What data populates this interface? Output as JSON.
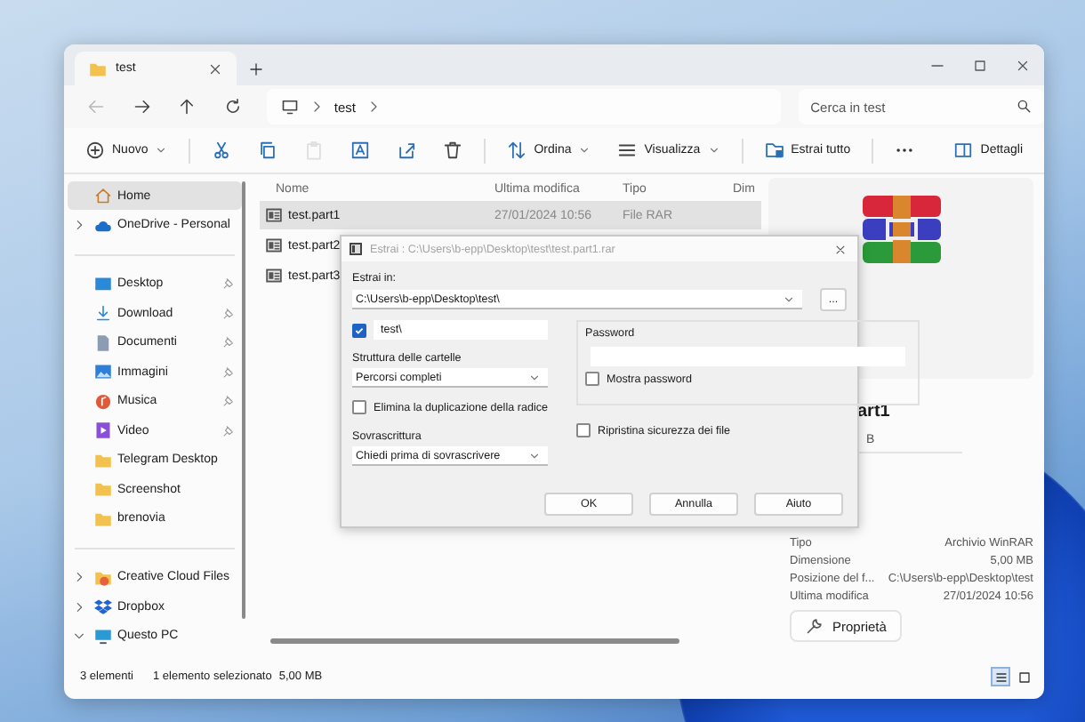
{
  "window": {
    "tabs": [
      {
        "label": "test",
        "selected": true
      }
    ]
  },
  "address": {
    "nav": [
      {
        "kind": "back",
        "disabled": true
      },
      {
        "kind": "forward",
        "disabled": false
      },
      {
        "kind": "up",
        "disabled": false
      },
      {
        "kind": "refresh",
        "disabled": false
      }
    ],
    "crumbs": [
      "test"
    ],
    "search": {
      "placeholder": "Cerca in test"
    }
  },
  "toolbar": {
    "groups": [
      [
        {
          "kind": "new",
          "label": "Nuovo",
          "disabled": false
        }
      ],
      [
        {
          "kind": "cut",
          "disabled": false
        },
        {
          "kind": "copy",
          "disabled": false
        },
        {
          "kind": "paste",
          "disabled": true
        },
        {
          "kind": "rename",
          "disabled": false
        },
        {
          "kind": "share",
          "disabled": false
        },
        {
          "kind": "delete",
          "disabled": false
        }
      ],
      [
        {
          "kind": "sort",
          "label": "Ordina",
          "disabled": false
        },
        {
          "kind": "view",
          "label": "Visualizza",
          "disabled": false
        }
      ],
      [
        {
          "kind": "extract",
          "label": "Estrai tutto",
          "disabled": false
        }
      ],
      [
        {
          "kind": "more",
          "disabled": false
        }
      ]
    ],
    "details": {
      "label": "Dettagli"
    }
  },
  "sidebar": {
    "groups": [
      [
        {
          "label": "Home",
          "kind": "home",
          "selected": true,
          "pinned": false
        },
        {
          "label": "OneDrive - Personal",
          "kind": "cloud",
          "selected": false,
          "pinned": false,
          "expanded": false
        }
      ],
      [
        {
          "label": "Desktop",
          "kind": "desktop",
          "selected": false,
          "pinned": true
        },
        {
          "label": "Download",
          "kind": "download",
          "selected": false,
          "pinned": true
        },
        {
          "label": "Documenti",
          "kind": "document",
          "selected": false,
          "pinned": true
        },
        {
          "label": "Immagini",
          "kind": "pictures",
          "selected": false,
          "pinned": true
        },
        {
          "label": "Musica",
          "kind": "music",
          "selected": false,
          "pinned": true
        },
        {
          "label": "Video",
          "kind": "video",
          "selected": false,
          "pinned": true
        },
        {
          "label": "Telegram Desktop",
          "kind": "folder",
          "selected": false,
          "pinned": false
        },
        {
          "label": "Screenshot",
          "kind": "folder",
          "selected": false,
          "pinned": false
        },
        {
          "label": "brenovia",
          "kind": "folder",
          "selected": false,
          "pinned": false
        }
      ],
      [
        {
          "label": "Creative Cloud Files",
          "kind": "ccfolder",
          "selected": false,
          "pinned": false,
          "expanded": false
        },
        {
          "label": "Dropbox",
          "kind": "box",
          "selected": false,
          "pinned": false,
          "expanded": false
        },
        {
          "label": "Questo PC",
          "kind": "pc",
          "selected": false,
          "pinned": false,
          "expanded": true
        }
      ]
    ]
  },
  "file_list": {
    "columns": [
      "Nome",
      "Ultima modifica",
      "Tipo",
      "Dim"
    ],
    "rows": [
      {
        "name": "test.part1",
        "modified": "27/01/2024 10:56",
        "type": "File RAR",
        "selected": true
      },
      {
        "name": "test.part2",
        "selected": false
      },
      {
        "name": "test.part3",
        "selected": false
      }
    ]
  },
  "details_pane": {
    "title": "art1",
    "subtitle": "B",
    "properties": [
      {
        "label": "Tipo",
        "value": "Archivio WinRAR"
      },
      {
        "label": "Dimensione",
        "value": "5,00 MB"
      },
      {
        "label": "Posizione del f...",
        "value": "C:\\Users\\b-epp\\Desktop\\test"
      },
      {
        "label": "Ultima modifica",
        "value": "27/01/2024 10:56"
      }
    ],
    "button": "Proprietà"
  },
  "status_bar": {
    "count": "3 elementi",
    "selection": "1 elemento selezionato",
    "size": "5,00 MB",
    "views": [
      {
        "kind": "details",
        "selected": true
      },
      {
        "kind": "tiles",
        "selected": false
      }
    ]
  },
  "dialog": {
    "title": "Estrai : C:\\Users\\b-epp\\Desktop\\test\\test.part1.rar",
    "extract_to": {
      "label": "Estrai in:",
      "value": "C:\\Users\\b-epp\\Desktop\\test\\",
      "browse": "..."
    },
    "subfolder": {
      "checked": true,
      "value": "test\\"
    },
    "structure": {
      "label": "Struttura delle cartelle",
      "value": "Percorsi completi"
    },
    "remove_root": {
      "label": "Elimina la duplicazione della radice",
      "checked": false
    },
    "overwrite": {
      "label": "Sovrascrittura",
      "value": "Chiedi prima di sovrascrivere"
    },
    "password": {
      "label": "Password"
    },
    "show_password": {
      "label": "Mostra password",
      "checked": false
    },
    "restore_security": {
      "label": "Ripristina sicurezza dei file",
      "checked": false
    },
    "buttons": [
      "OK",
      "Annulla",
      "Aiuto"
    ]
  }
}
